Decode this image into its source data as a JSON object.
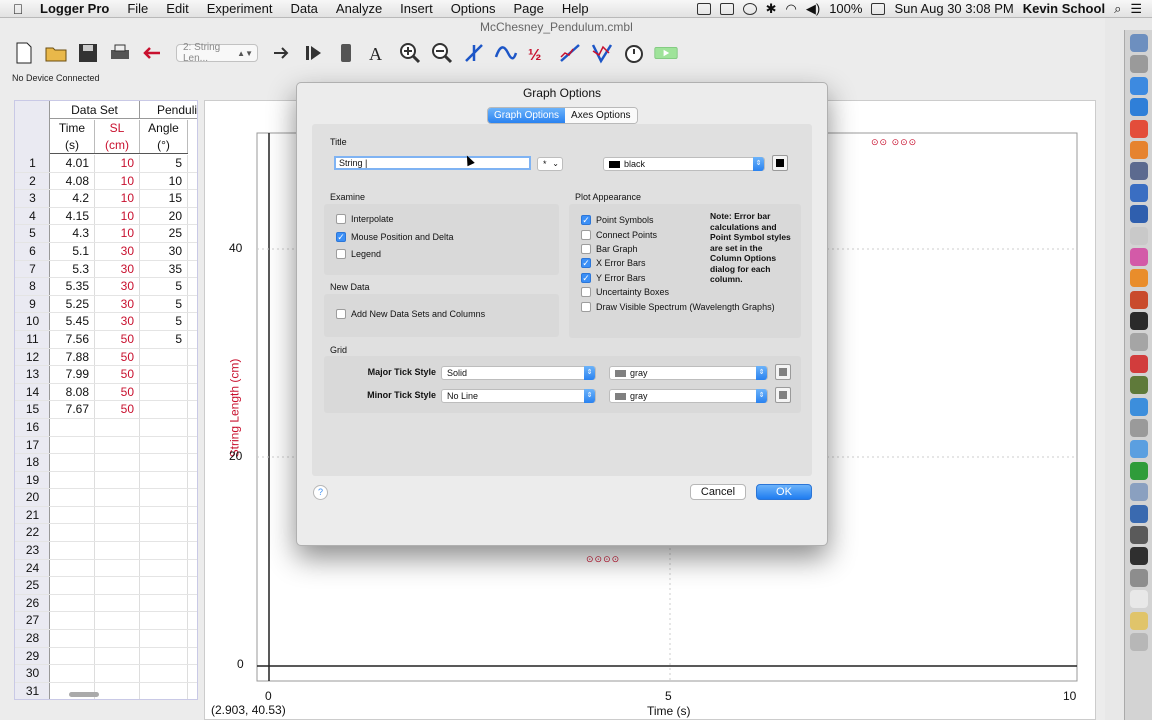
{
  "menubar": {
    "apple": "",
    "app": "Logger Pro",
    "items": [
      "File",
      "Edit",
      "Experiment",
      "Data",
      "Analyze",
      "Insert",
      "Options",
      "Page",
      "Help"
    ],
    "battery": "100%",
    "datetime": "Sun Aug 30  3:08 PM",
    "user": "Kevin School"
  },
  "window": {
    "doc_title": "McChesney_Pendulum.cmbl",
    "status": "No Device Connected",
    "toolbar_select": "2: String Len..."
  },
  "table": {
    "group_title": "Data Set",
    "group_title_2": "Penduli",
    "columns": [
      {
        "name": "Time",
        "unit": "(s)",
        "color": "#111111"
      },
      {
        "name": "SL",
        "unit": "(cm)",
        "color": "#c8102e"
      },
      {
        "name": "Angle",
        "unit": "(°)",
        "color": "#111111"
      }
    ],
    "rows": [
      [
        "1",
        "4.01",
        "10",
        "5"
      ],
      [
        "2",
        "4.08",
        "10",
        "10"
      ],
      [
        "3",
        "4.2",
        "10",
        "15"
      ],
      [
        "4",
        "4.15",
        "10",
        "20"
      ],
      [
        "5",
        "4.3",
        "10",
        "25"
      ],
      [
        "6",
        "5.1",
        "30",
        "30"
      ],
      [
        "7",
        "5.3",
        "30",
        "35"
      ],
      [
        "8",
        "5.35",
        "30",
        "5"
      ],
      [
        "9",
        "5.25",
        "30",
        "5"
      ],
      [
        "10",
        "5.45",
        "30",
        "5"
      ],
      [
        "11",
        "7.56",
        "50",
        "5"
      ],
      [
        "12",
        "7.88",
        "50",
        ""
      ],
      [
        "13",
        "7.99",
        "50",
        ""
      ],
      [
        "14",
        "8.08",
        "50",
        ""
      ],
      [
        "15",
        "7.67",
        "50",
        ""
      ],
      [
        "16",
        "",
        "",
        ""
      ],
      [
        "17",
        "",
        "",
        ""
      ],
      [
        "18",
        "",
        "",
        ""
      ],
      [
        "19",
        "",
        "",
        ""
      ],
      [
        "20",
        "",
        "",
        ""
      ],
      [
        "21",
        "",
        "",
        ""
      ],
      [
        "22",
        "",
        "",
        ""
      ],
      [
        "23",
        "",
        "",
        ""
      ],
      [
        "24",
        "",
        "",
        ""
      ],
      [
        "25",
        "",
        "",
        ""
      ],
      [
        "26",
        "",
        "",
        ""
      ],
      [
        "27",
        "",
        "",
        ""
      ],
      [
        "28",
        "",
        "",
        ""
      ],
      [
        "29",
        "",
        "",
        ""
      ],
      [
        "30",
        "",
        "",
        ""
      ],
      [
        "31",
        "",
        "",
        ""
      ]
    ]
  },
  "graph": {
    "ylabel": "String Length  (cm)",
    "xlabel": "Time (s)",
    "coord_readout": "(2.903, 40.53)",
    "yticks": [
      "40",
      "20",
      "0"
    ],
    "xticks": [
      "0",
      "5",
      "10"
    ],
    "marker_top": "⊙⊙  ⊙⊙⊙",
    "marker_mid": "⊙⊙⊙⊙"
  },
  "dialog": {
    "title": "Graph Options",
    "tabs": [
      "Graph Options",
      "Axes Options"
    ],
    "title_section": "Title",
    "title_value": "String |",
    "title_font_popup": "*",
    "title_color": "black",
    "examine": {
      "label": "Examine",
      "interpolate": "Interpolate",
      "mouse": "Mouse Position and Delta",
      "legend": "Legend"
    },
    "new_data": {
      "label": "New Data",
      "add": "Add New Data Sets and Columns"
    },
    "plot": {
      "label": "Plot Appearance",
      "point_symbols": "Point Symbols",
      "connect_points": "Connect Points",
      "bar_graph": "Bar Graph",
      "x_error": "X Error Bars",
      "y_error": "Y Error Bars",
      "uncertainty": "Uncertainty Boxes",
      "spectrum": "Draw Visible Spectrum (Wavelength Graphs)",
      "note": "Note: Error bar calculations and Point Symbol styles are set in the Column Options dialog for each column."
    },
    "grid": {
      "label": "Grid",
      "major_label": "Major Tick Style",
      "major_style": "Solid",
      "major_color": "gray",
      "minor_label": "Minor Tick Style",
      "minor_style": "No Line",
      "minor_color": "gray"
    },
    "help": "?",
    "cancel": "Cancel",
    "ok": "OK"
  },
  "colors": {
    "accent": "#2a82f0",
    "series_red": "#c8102e"
  }
}
